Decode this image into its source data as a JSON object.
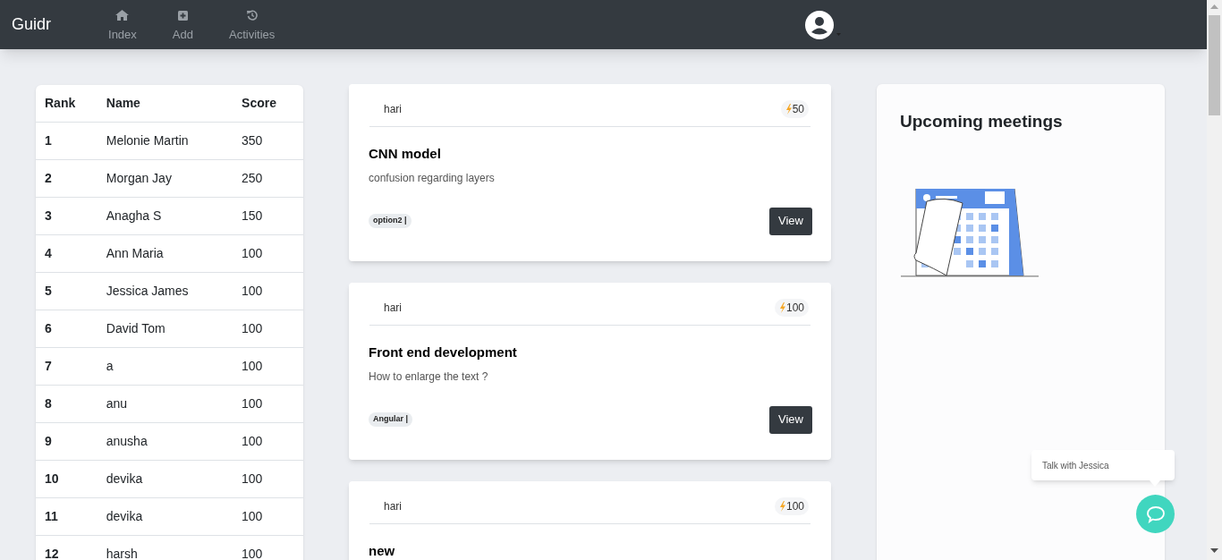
{
  "navbar": {
    "brand": "Guidr",
    "links": [
      {
        "label": "Index"
      },
      {
        "label": "Add"
      },
      {
        "label": "Activities"
      }
    ]
  },
  "leaderboard": {
    "columns": [
      "Rank",
      "Name",
      "Score"
    ],
    "rows": [
      [
        "1",
        "Melonie Martin",
        "350"
      ],
      [
        "2",
        "Morgan Jay",
        "250"
      ],
      [
        "3",
        "Anagha S",
        "150"
      ],
      [
        "4",
        "Ann Maria",
        "100"
      ],
      [
        "5",
        "Jessica James",
        "100"
      ],
      [
        "6",
        "David Tom",
        "100"
      ],
      [
        "7",
        "a",
        "100"
      ],
      [
        "8",
        "anu",
        "100"
      ],
      [
        "9",
        "anusha",
        "100"
      ],
      [
        "10",
        "devika",
        "100"
      ],
      [
        "11",
        "devika",
        "100"
      ],
      [
        "12",
        "harsh",
        "100"
      ]
    ]
  },
  "questions": [
    {
      "author": "hari",
      "points": "50",
      "title": "CNN model",
      "description": "confusion regarding layers",
      "tag": "option2 |",
      "button": "View"
    },
    {
      "author": "hari",
      "points": "100",
      "title": "Front end development",
      "description": "How to enlarge the text ?",
      "tag": "Angular |",
      "button": "View"
    },
    {
      "author": "hari",
      "points": "100",
      "title": "new"
    }
  ],
  "meetings": {
    "title": "Upcoming meetings"
  },
  "chat": {
    "prompt": "Talk with Jessica"
  }
}
